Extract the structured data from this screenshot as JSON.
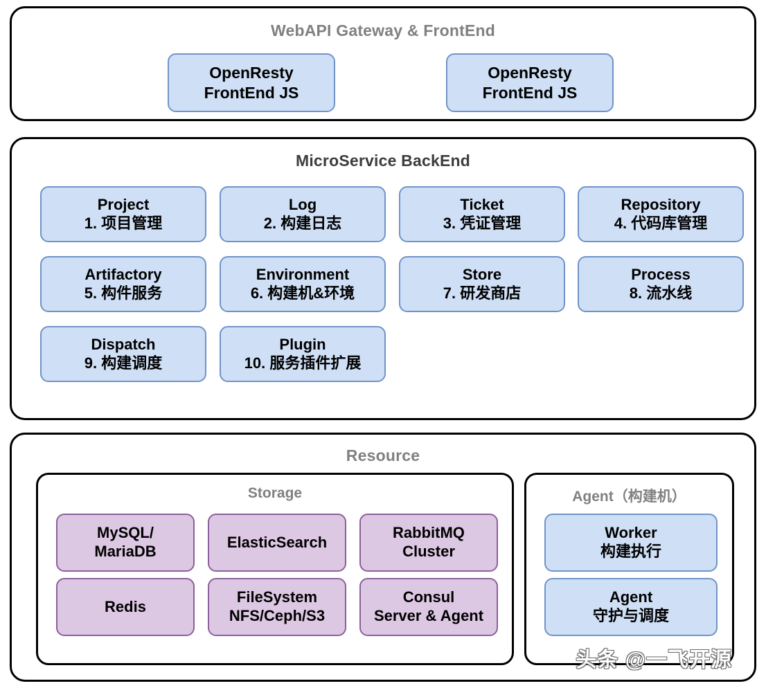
{
  "diagram": {
    "sections": [
      {
        "id": "gateway",
        "title": "WebAPI Gateway & FrontEnd",
        "nodes": [
          {
            "line1": "OpenResty",
            "line2": "FrontEnd JS",
            "color": "#cfdff5"
          },
          {
            "line1": "OpenResty",
            "line2": "FrontEnd JS",
            "color": "#cfdff5"
          }
        ]
      },
      {
        "id": "backend",
        "title": "MicroService BackEnd",
        "nodes": [
          {
            "line1": "Project",
            "line2": "1. 项目管理",
            "color": "#cfdff5"
          },
          {
            "line1": "Log",
            "line2": "2. 构建日志",
            "color": "#cfdff5"
          },
          {
            "line1": "Ticket",
            "line2": "3. 凭证管理",
            "color": "#cfdff5"
          },
          {
            "line1": "Repository",
            "line2": "4. 代码库管理",
            "color": "#cfdff5"
          },
          {
            "line1": "Artifactory",
            "line2": "5. 构件服务",
            "color": "#cfdff5"
          },
          {
            "line1": "Environment",
            "line2": "6. 构建机&环境",
            "color": "#cfdff5"
          },
          {
            "line1": "Store",
            "line2": "7. 研发商店",
            "color": "#cfdff5"
          },
          {
            "line1": "Process",
            "line2": "8. 流水线",
            "color": "#cfdff5"
          },
          {
            "line1": "Dispatch",
            "line2": "9. 构建调度",
            "color": "#cfdff5"
          },
          {
            "line1": "Plugin",
            "line2": "10. 服务插件扩展",
            "color": "#cfdff5"
          }
        ]
      },
      {
        "id": "resource",
        "title": "Resource",
        "subsections": [
          {
            "id": "storage",
            "title": "Storage",
            "nodes": [
              {
                "line1": "MySQL/",
                "line2": "MariaDB",
                "color": "#ddc8e3"
              },
              {
                "line1": "ElasticSearch",
                "line2": "",
                "color": "#ddc8e3"
              },
              {
                "line1": "RabbitMQ",
                "line2": "Cluster",
                "color": "#ddc8e3"
              },
              {
                "line1": "Redis",
                "line2": "",
                "color": "#ddc8e3"
              },
              {
                "line1": "FileSystem",
                "line2": "NFS/Ceph/S3",
                "color": "#ddc8e3"
              },
              {
                "line1": "Consul",
                "line2": "Server & Agent",
                "color": "#ddc8e3"
              }
            ]
          },
          {
            "id": "agent",
            "title": "Agent（构建机）",
            "nodes": [
              {
                "line1": "Worker",
                "line2": "构建执行",
                "color": "#cfdff5"
              },
              {
                "line1": "Agent",
                "line2": "守护与调度",
                "color": "#cfdff5"
              }
            ]
          }
        ]
      }
    ],
    "watermark": "头条 @一飞开源",
    "colors": {
      "blue_fill": "#cfdff5",
      "blue_border": "#6f93c9",
      "purple_fill": "#ddc8e3",
      "purple_border": "#8b5f9b",
      "panel_border": "#000000",
      "title_gray": "#808080",
      "title_dark": "#3d3d3d"
    }
  }
}
